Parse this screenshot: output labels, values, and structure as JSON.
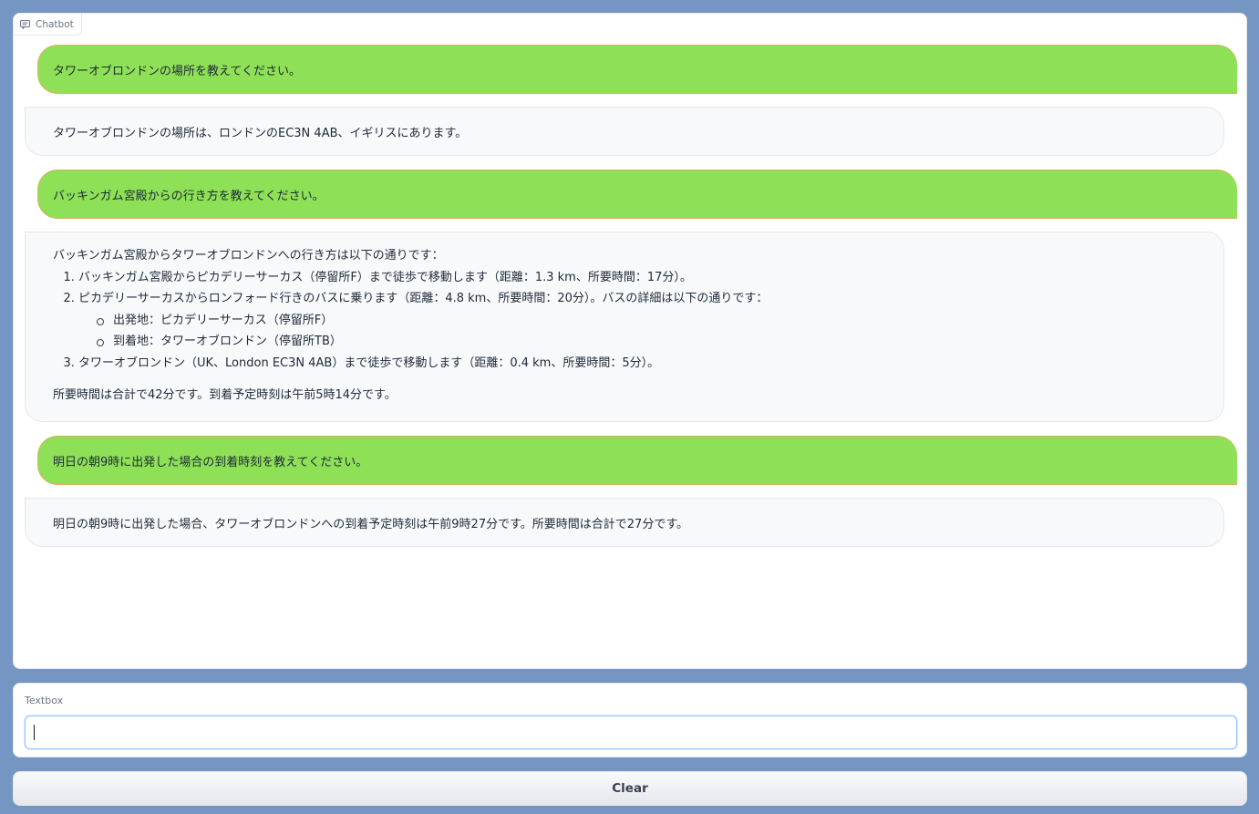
{
  "chatbot": {
    "label": "Chatbot",
    "messages": [
      {
        "role": "user",
        "text": "タワーオブロンドンの場所を教えてください。"
      },
      {
        "role": "bot",
        "text": "タワーオブロンドンの場所は、ロンドンのEC3N 4AB、イギリスにあります。"
      },
      {
        "role": "user",
        "text": "バッキンガム宮殿からの行き方を教えてください。"
      },
      {
        "role": "bot",
        "intro": "バッキンガム宮殿からタワーオブロンドンへの行き方は以下の通りです：",
        "steps": [
          "バッキンガム宮殿からピカデリーサーカス（停留所F）まで徒歩で移動します（距離：1.3 km、所要時間：17分）。",
          "ピカデリーサーカスからロンフォード行きのバスに乗ります（距離：4.8 km、所要時間：20分）。バスの詳細は以下の通りです：",
          "タワーオブロンドン（UK、London EC3N 4AB）まで徒歩で移動します（距離：0.4 km、所要時間：5分）。"
        ],
        "bus_details": [
          "出発地：ピカデリーサーカス（停留所F）",
          "到着地：タワーオブロンドン（停留所TB）"
        ],
        "total": "所要時間は合計で42分です。到着予定時刻は午前5時14分です。"
      },
      {
        "role": "user",
        "text": "明日の朝9時に出発した場合の到着時刻を教えてください。"
      },
      {
        "role": "bot",
        "text": "明日の朝9時に出発した場合、タワーオブロンドンへの到着予定時刻は午前9時27分です。所要時間は合計で27分です。"
      }
    ]
  },
  "textbox": {
    "label": "Textbox",
    "value": "",
    "placeholder": ""
  },
  "clear_button": {
    "label": "Clear"
  },
  "colors": {
    "background": "#7596c3",
    "user_bubble": "#8ee057",
    "user_bubble_border": "#d6b35c",
    "bot_bubble": "#f8f9fb"
  },
  "icons": {
    "chatbot_label": "chat-bubble-icon"
  }
}
